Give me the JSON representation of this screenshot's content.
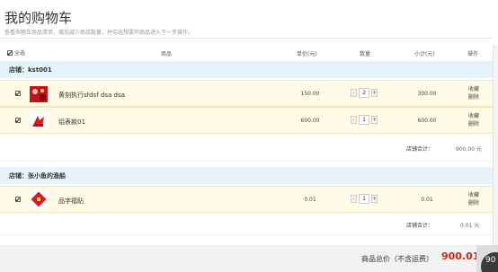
{
  "page": {
    "title": "我的购物车",
    "subtitle": "查看购物车商品清单，增加减少商品数量，并勾选想要的商品进入下一步操作。"
  },
  "header": {
    "select_all": "全选",
    "product": "商品",
    "price": "单价(元)",
    "qty": "数量",
    "subtotal": "小计(元)",
    "ops": "操作"
  },
  "stores": [
    {
      "name": "店铺：kst001",
      "items": [
        {
          "name": "黄刻执行sfdsf dsa dsa",
          "price": "150.00",
          "qty": "2",
          "subtotal": "300.00",
          "fav": "收藏",
          "del": "删除",
          "checked": true
        },
        {
          "name": "铝表款01",
          "price": "600.00",
          "qty": "1",
          "subtotal": "600.00",
          "fav": "收藏",
          "del": "删除",
          "checked": true
        }
      ],
      "total_label": "店铺合计：",
      "total": "900.00 元"
    },
    {
      "name": "店铺：张小鱼的渔船",
      "items": [
        {
          "name": "品字福贴",
          "price": "0.01",
          "qty": "1",
          "subtotal": "0.01",
          "fav": "收藏",
          "del": "删除",
          "checked": true
        }
      ],
      "total_label": "店铺合计：",
      "total": "0.01 元"
    }
  ],
  "footer": {
    "total_label": "商品总价（不含运费）",
    "total": "900.01",
    "badge": "90"
  },
  "colors": {
    "store_bar": "#e6f3fb",
    "item_row": "#fffbe6",
    "total_red": "#d9230f"
  },
  "icons": {
    "checkbox": "checkbox-icon",
    "minus": "minus-icon",
    "plus": "plus-icon"
  }
}
